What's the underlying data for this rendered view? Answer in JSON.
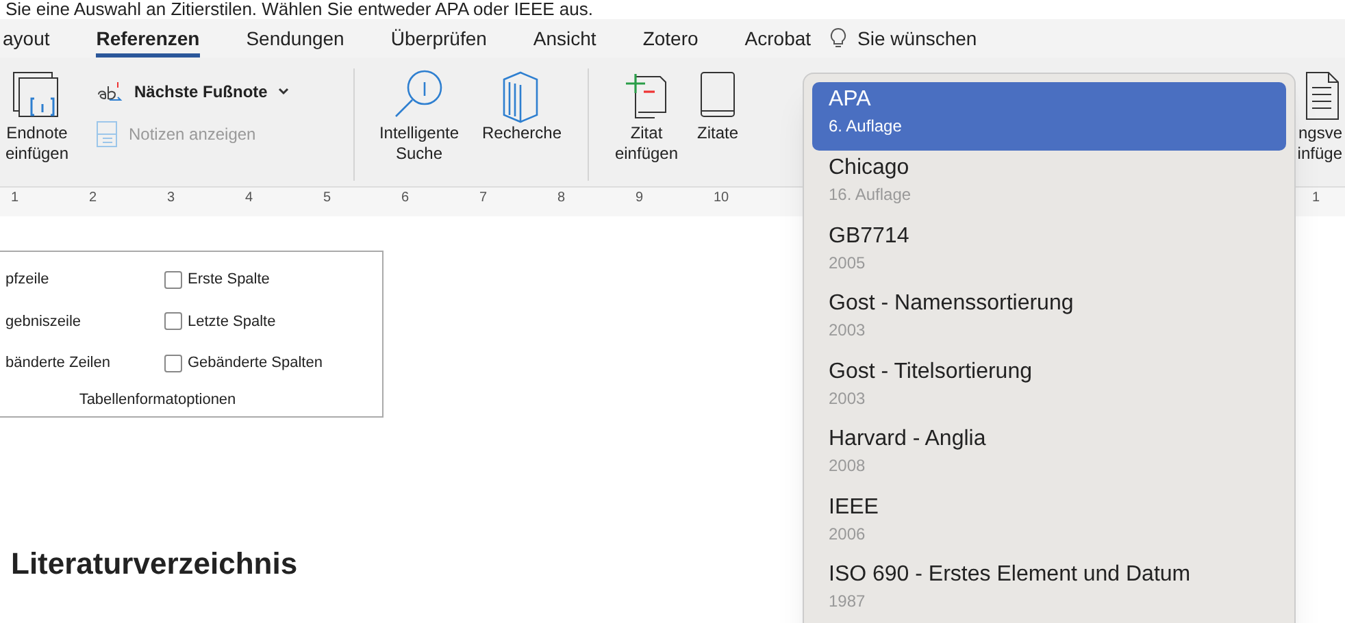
{
  "caption": "Sie eine Auswahl an Zitierstilen. Wählen Sie entweder APA oder IEEE aus.",
  "tabs": [
    {
      "label": "ayout",
      "selected": false
    },
    {
      "label": "Referenzen",
      "selected": true
    },
    {
      "label": "Sendungen",
      "selected": false
    },
    {
      "label": "Überprüfen",
      "selected": false
    },
    {
      "label": "Ansicht",
      "selected": false
    },
    {
      "label": "Zotero",
      "selected": false
    },
    {
      "label": "Acrobat",
      "selected": false
    }
  ],
  "tell_me": "Sie wünschen",
  "ribbon": {
    "endnote": [
      "Endnote",
      "einfügen"
    ],
    "next_footnote": "Nächste Fußnote",
    "show_notes": {
      "label": "Notizen anzeigen",
      "disabled": true
    },
    "smart_lookup": [
      "Intelligente",
      "Suche"
    ],
    "researcher": "Recherche",
    "insert_citation": [
      "Zitat",
      "einfügen"
    ],
    "citations": "Zitate",
    "bibliography_cut": [
      "ngsve",
      "infüge"
    ]
  },
  "ruler": [
    "1",
    "2",
    "3",
    "4",
    "5",
    "6",
    "7",
    "8",
    "9",
    "10",
    "1"
  ],
  "table_options": {
    "left": [
      "pfzeile",
      "gebniszeile",
      "bänderte Zeilen"
    ],
    "right": [
      {
        "label": "Erste Spalte",
        "checked": false
      },
      {
        "label": "Letzte Spalte",
        "checked": false
      },
      {
        "label": "Gebänderte Spalten",
        "checked": false
      }
    ],
    "title": "Tabellenformatoptionen"
  },
  "heading": "Literaturverzeichnis",
  "styles": [
    {
      "name": "APA",
      "edition": "6. Auflage",
      "selected": true
    },
    {
      "name": "Chicago",
      "edition": "16. Auflage",
      "selected": false
    },
    {
      "name": "GB7714",
      "edition": "2005",
      "selected": false
    },
    {
      "name": "Gost - Namenssortierung",
      "edition": "2003",
      "selected": false
    },
    {
      "name": "Gost - Titelsortierung",
      "edition": "2003",
      "selected": false
    },
    {
      "name": "Harvard - Anglia",
      "edition": "2008",
      "selected": false
    },
    {
      "name": "IEEE",
      "edition": "2006",
      "selected": false
    },
    {
      "name": "ISO 690 - Erstes Element und Datum",
      "edition": "1987",
      "selected": false
    }
  ]
}
